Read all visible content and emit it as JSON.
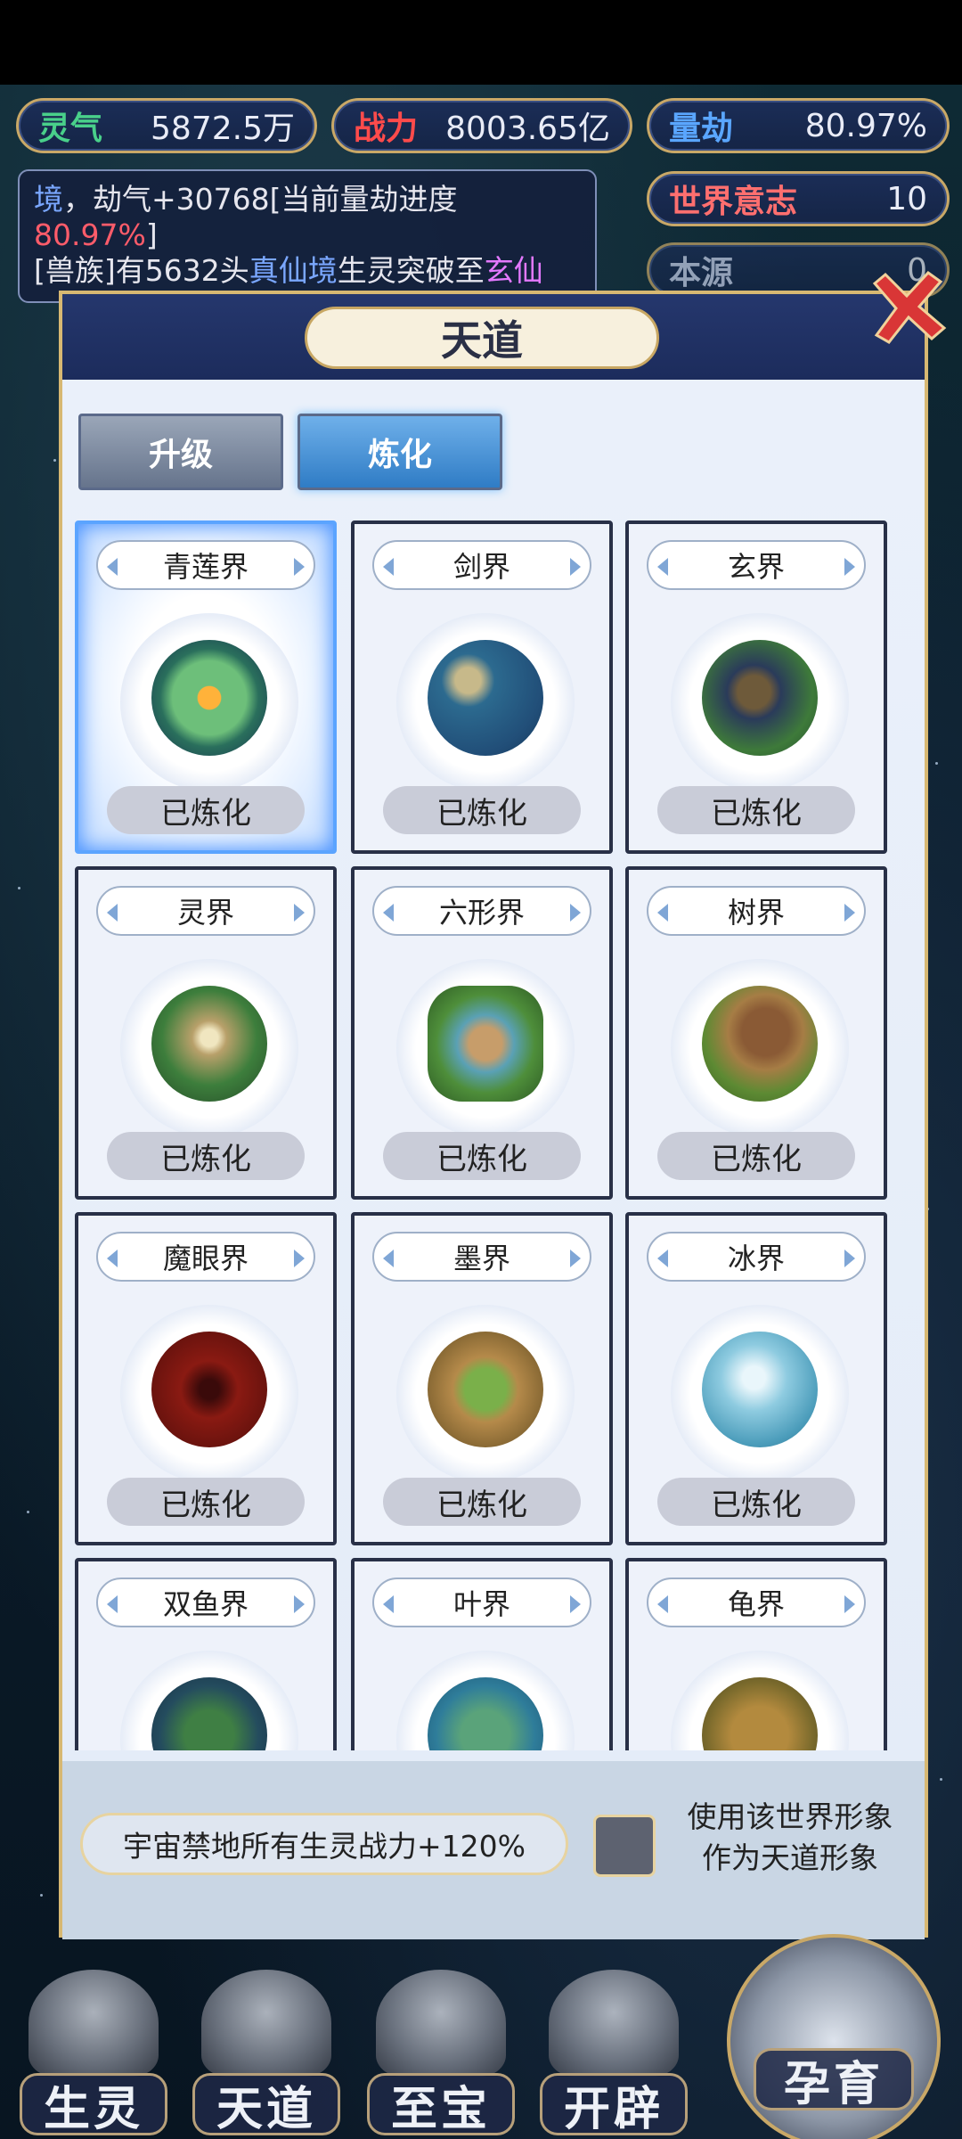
{
  "top_stats": {
    "lingqi": {
      "label": "灵气",
      "value": "5872.5万"
    },
    "zhanli": {
      "label": "战力",
      "value": "8003.65亿"
    },
    "liangjie": {
      "label": "量劫",
      "value": "80.97%"
    },
    "world_will": {
      "label": "世界意志",
      "value": "10"
    },
    "source": {
      "label": "本源",
      "value": "0"
    }
  },
  "log": {
    "line1_a": "境",
    "line1_b": "，劫气+30768[当前量劫进度",
    "line2": "80.97%",
    "line2_end": "]",
    "line3_a": "[兽族]有5632头",
    "line3_b": "真仙境",
    "line3_c": "生灵突破至",
    "line3_d": "玄仙"
  },
  "dialog": {
    "title": "天道",
    "tabs": [
      {
        "label": "升级",
        "active": false
      },
      {
        "label": "炼化",
        "active": true
      }
    ],
    "worlds": [
      {
        "name": "青莲界",
        "status": "已炼化",
        "selected": true
      },
      {
        "name": "剑界",
        "status": "已炼化",
        "selected": false
      },
      {
        "name": "玄界",
        "status": "已炼化",
        "selected": false
      },
      {
        "name": "灵界",
        "status": "已炼化",
        "selected": false
      },
      {
        "name": "六形界",
        "status": "已炼化",
        "selected": false
      },
      {
        "name": "树界",
        "status": "已炼化",
        "selected": false
      },
      {
        "name": "魔眼界",
        "status": "已炼化",
        "selected": false
      },
      {
        "name": "墨界",
        "status": "已炼化",
        "selected": false
      },
      {
        "name": "冰界",
        "status": "已炼化",
        "selected": false
      },
      {
        "name": "双鱼界",
        "status": "",
        "selected": false
      },
      {
        "name": "叶界",
        "status": "",
        "selected": false
      },
      {
        "name": "龟界",
        "status": "",
        "selected": false
      }
    ],
    "buff_text": "宇宙禁地所有生灵战力+120%",
    "use_world_label_1": "使用该世界形象",
    "use_world_label_2": "作为天道形象",
    "use_world_checked": false
  },
  "nav": [
    {
      "label": "生灵"
    },
    {
      "label": "天道"
    },
    {
      "label": "至宝"
    },
    {
      "label": "开辟"
    },
    {
      "label": "孕育"
    }
  ],
  "colors": {
    "accent_gold": "#c9a867",
    "dialog_blue": "#1f3168",
    "active_tab": "#2f7cc5",
    "log_red": "#ff5c6a",
    "log_blue": "#7aa7ff"
  },
  "icons": {
    "close": "close-x-icon"
  }
}
